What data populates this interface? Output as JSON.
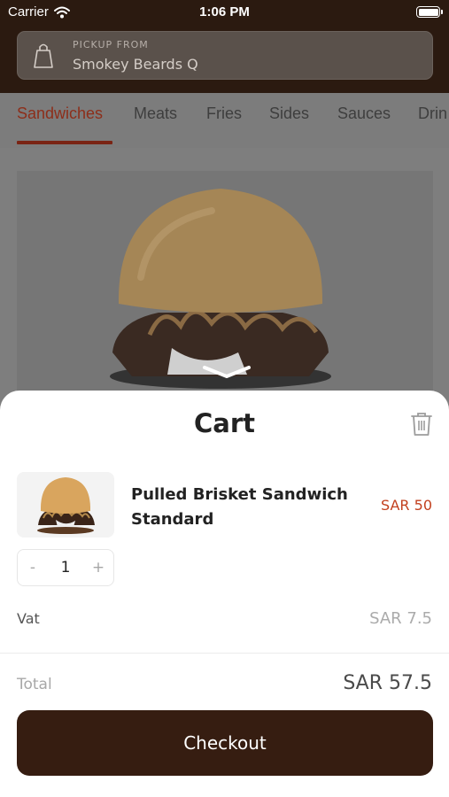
{
  "status_bar": {
    "carrier": "Carrier",
    "time": "1:06 PM"
  },
  "pickup": {
    "label": "PICKUP FROM",
    "location": "Smokey Beards Q"
  },
  "categories": [
    "Sandwiches",
    "Meats",
    "Fries",
    "Sides",
    "Sauces",
    "Drin"
  ],
  "active_category": "Sandwiches",
  "cart": {
    "title": "Cart",
    "item": {
      "name_line1": "Pulled Brisket Sandwich",
      "name_line2": "Standard",
      "price": "SAR 50",
      "quantity": "1",
      "minus": "-",
      "plus": "+"
    },
    "vat_label": "Vat",
    "vat_value": "SAR 7.5",
    "total_label": "Total",
    "total_value": "SAR 57.5",
    "checkout_label": "Checkout"
  },
  "colors": {
    "brand_dark": "#361d11",
    "accent": "#c2401e"
  },
  "icons": [
    "wifi-icon",
    "battery-icon",
    "shopping-bag-icon",
    "chevron-down-icon",
    "trash-icon"
  ]
}
